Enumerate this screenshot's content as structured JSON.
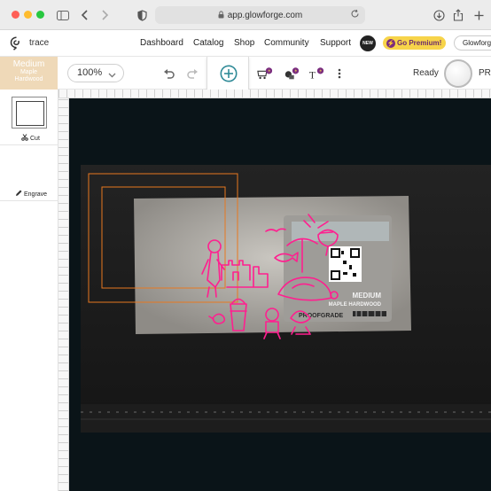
{
  "browser": {
    "url": "app.glowforge.com",
    "icons": [
      "sidebar-icon",
      "back-icon",
      "forward-icon",
      "shield-icon",
      "lock-icon",
      "reload-icon",
      "download-icon",
      "share-icon",
      "new-tab-icon"
    ]
  },
  "app_nav": {
    "doc_title": "trace",
    "links": [
      "Dashboard",
      "Catalog",
      "Shop",
      "Community",
      "Support"
    ],
    "new_badge": "NEW",
    "premium_label": "Go Premium!",
    "device_name": "Glowforge"
  },
  "toolbar": {
    "material_name": "Medium",
    "material_line2": "Maple",
    "material_line3": "Hardwood",
    "zoom": "100%",
    "status": "Ready",
    "print_label": "PR"
  },
  "left_panel": {
    "steps": [
      {
        "label": "Cut",
        "icon": "scissors-icon"
      },
      {
        "label": "Engrave",
        "icon": "pencil-icon"
      }
    ]
  },
  "bed": {
    "material_label_line1": "MEDIUM",
    "material_label_line2": "MAPLE HARDWOOD",
    "brand": "PROOFGRADE"
  },
  "colors": {
    "premium": "#f7d44a",
    "material_tag": "#efd9b8",
    "accent": "#2f8a97",
    "cut_outline": "#e8781f",
    "engrave_artwork": "#ff1f8f",
    "bed_background": "#0a1418"
  }
}
